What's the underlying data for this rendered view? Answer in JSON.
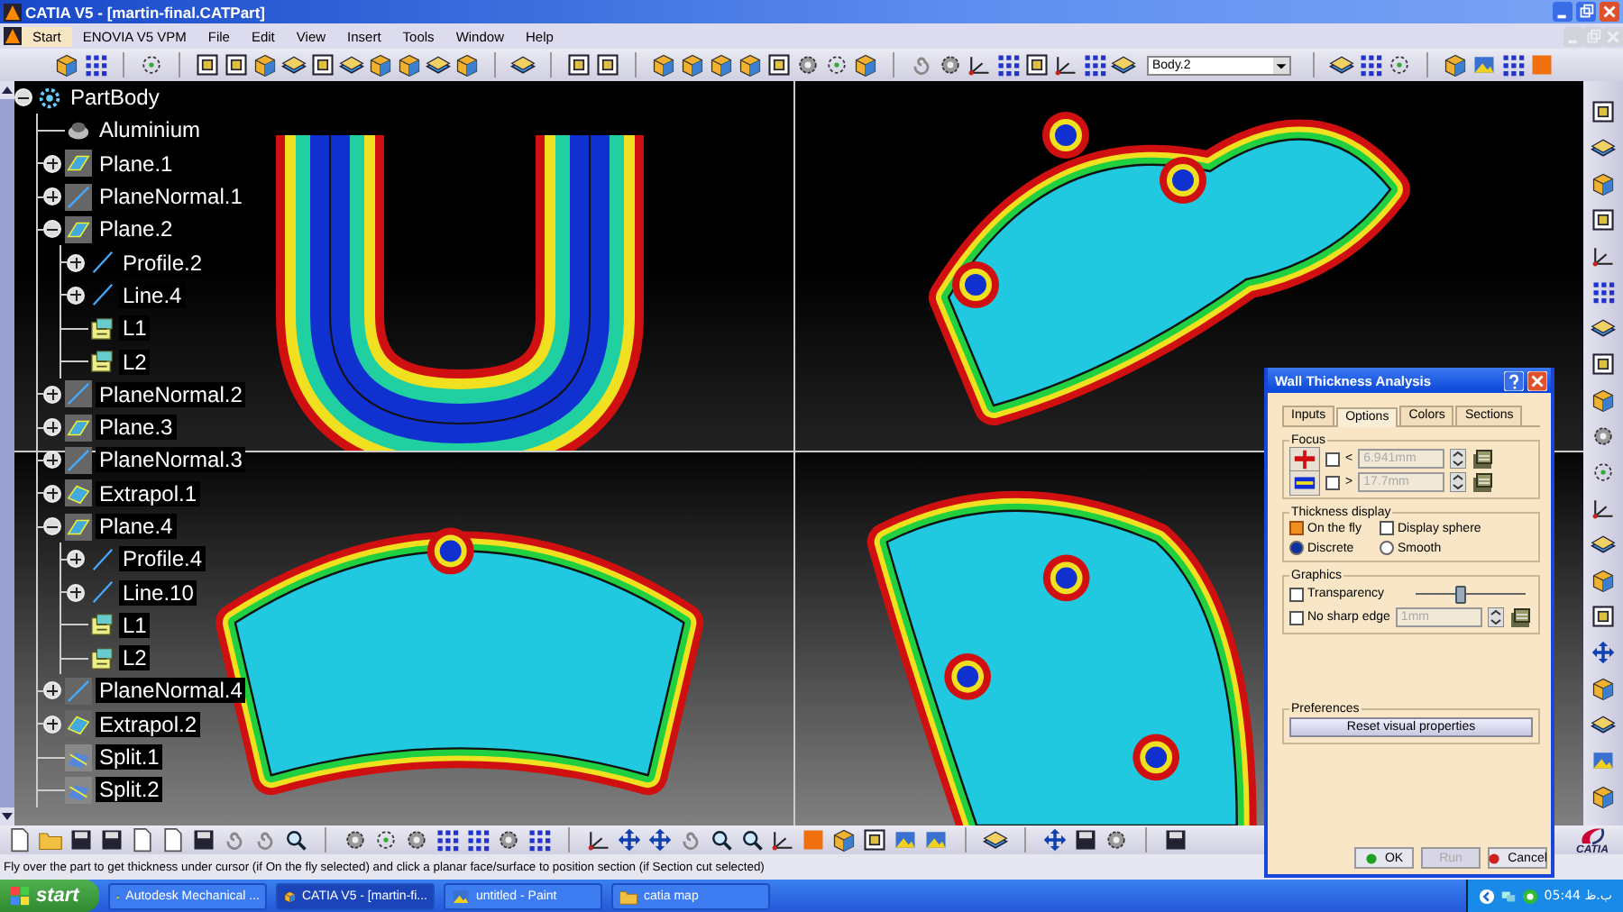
{
  "window": {
    "title": "CATIA V5 - [martin-final.CATPart]"
  },
  "menu": [
    {
      "label": "Start",
      "selected": true
    },
    {
      "label": "ENOVIA V5 VPM",
      "selected": false
    },
    {
      "label": "File",
      "selected": false
    },
    {
      "label": "Edit",
      "selected": false
    },
    {
      "label": "View",
      "selected": false
    },
    {
      "label": "Insert",
      "selected": false
    },
    {
      "label": "Tools",
      "selected": false
    },
    {
      "label": "Window",
      "selected": false
    },
    {
      "label": "Help",
      "selected": false
    }
  ],
  "toolbar": {
    "body_selector": {
      "value": "Body.2"
    }
  },
  "tree": [
    {
      "label": "PartBody",
      "kind": "body",
      "expanded": true,
      "children": [
        {
          "label": "Aluminium",
          "kind": "material"
        },
        {
          "label": "Plane.1",
          "kind": "plane",
          "expanded": false
        },
        {
          "label": "PlaneNormal.1",
          "kind": "line",
          "expanded": false
        },
        {
          "label": "Plane.2",
          "kind": "plane",
          "expanded": true,
          "children": [
            {
              "label": "Profile.2",
              "kind": "curve",
              "expanded": false
            },
            {
              "label": "Line.4",
              "kind": "curve",
              "expanded": false
            },
            {
              "label": "L1",
              "kind": "law"
            },
            {
              "label": "L2",
              "kind": "law"
            }
          ]
        },
        {
          "label": "PlaneNormal.2",
          "kind": "line",
          "expanded": false
        },
        {
          "label": "Plane.3",
          "kind": "plane",
          "expanded": false
        },
        {
          "label": "PlaneNormal.3",
          "kind": "line",
          "expanded": false
        },
        {
          "label": "Extrapol.1",
          "kind": "surface",
          "expanded": false
        },
        {
          "label": "Plane.4",
          "kind": "plane",
          "expanded": true,
          "children": [
            {
              "label": "Profile.4",
              "kind": "curve",
              "expanded": false
            },
            {
              "label": "Line.10",
              "kind": "curve",
              "expanded": false
            },
            {
              "label": "L1",
              "kind": "law"
            },
            {
              "label": "L2",
              "kind": "law"
            }
          ]
        },
        {
          "label": "PlaneNormal.4",
          "kind": "line",
          "expanded": false
        },
        {
          "label": "Extrapol.2",
          "kind": "surface",
          "expanded": false
        },
        {
          "label": "Split.1",
          "kind": "split"
        },
        {
          "label": "Split.2",
          "kind": "split"
        }
      ]
    }
  ],
  "dialog": {
    "title": "Wall Thickness Analysis",
    "tabs": [
      {
        "label": "Inputs",
        "selected": false
      },
      {
        "label": "Options",
        "selected": true
      },
      {
        "label": "Colors",
        "selected": false
      },
      {
        "label": "Sections",
        "selected": false
      }
    ],
    "focus": {
      "title": "Focus",
      "rows": [
        {
          "kind": "below",
          "checked": false,
          "operator": "<",
          "value": "6.941mm",
          "disabled": true
        },
        {
          "kind": "above",
          "checked": false,
          "operator": ">",
          "value": "17.7mm",
          "disabled": true
        }
      ]
    },
    "thickness_display": {
      "title": "Thickness display",
      "options": [
        {
          "label": "On the fly",
          "kind": "checkbox",
          "checked": true
        },
        {
          "label": "Display sphere",
          "kind": "checkbox",
          "checked": false
        },
        {
          "label": "Discrete",
          "kind": "radio",
          "selected": true
        },
        {
          "label": "Smooth",
          "kind": "radio",
          "selected": false
        }
      ]
    },
    "graphics": {
      "title": "Graphics",
      "transparency": {
        "label": "Transparency",
        "checked": false,
        "level": 0.4
      },
      "sharp_edge": {
        "label": "No sharp edge",
        "checked": false,
        "value": "1mm",
        "disabled": true
      }
    },
    "preferences": {
      "title": "Preferences",
      "button": "Reset visual properties"
    },
    "buttons": [
      {
        "label": "OK",
        "kind": "ok",
        "disabled": false
      },
      {
        "label": "Run",
        "kind": "run",
        "disabled": true
      },
      {
        "label": "Cancel",
        "kind": "cancel",
        "disabled": false
      }
    ]
  },
  "status_bar": {
    "text": "Fly over the part to get thickness under cursor (if On the fly selected) and click a planar face/surface to position section (if Section cut selected)"
  },
  "logo": {
    "text": "CATIA"
  },
  "taskbar": {
    "start": "start",
    "tasks": [
      {
        "label": "Autodesk Mechanical ...",
        "kind": "app",
        "selected": false
      },
      {
        "label": "CATIA V5 - [martin-fi...",
        "kind": "catia",
        "selected": true
      },
      {
        "label": "untitled - Paint",
        "kind": "paint",
        "selected": false
      },
      {
        "label": "catia map",
        "kind": "folder",
        "selected": false
      }
    ],
    "clock": "05:44 ب.ظ"
  }
}
